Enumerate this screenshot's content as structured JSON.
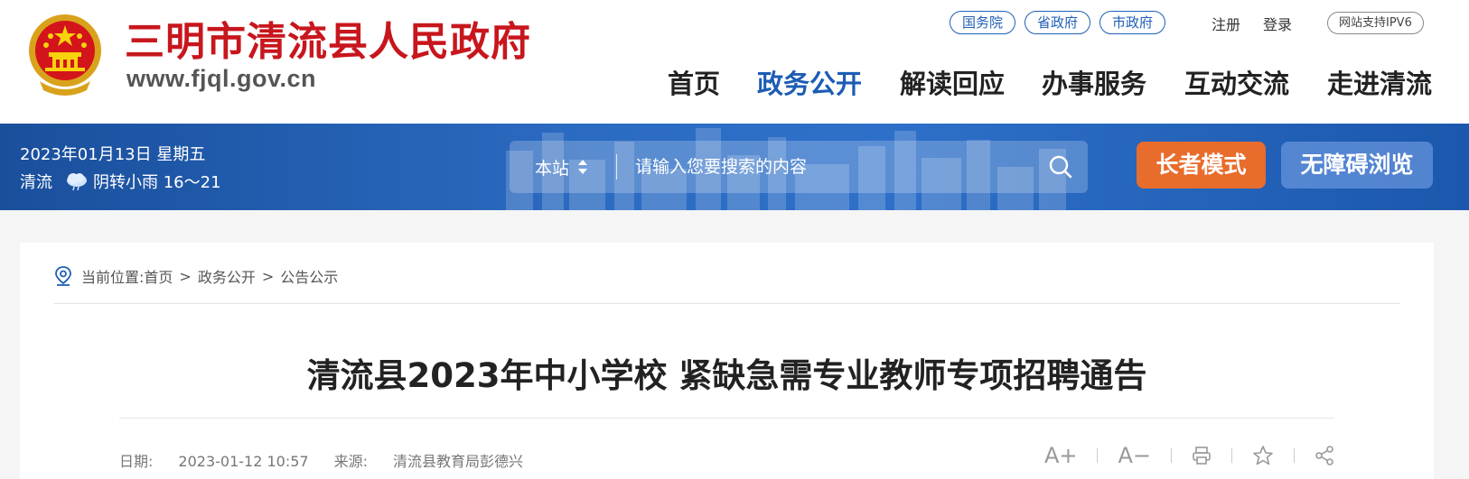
{
  "header": {
    "site_name": "三明市清流县人民政府",
    "site_domain": "www.fjql.gov.cn",
    "gov_links": [
      "国务院",
      "省政府",
      "市政府"
    ],
    "register": "注册",
    "login": "登录",
    "ipv6": "网站支持IPV6",
    "nav": [
      "首页",
      "政务公开",
      "解读回应",
      "办事服务",
      "互动交流",
      "走进清流"
    ],
    "active_nav": "政务公开"
  },
  "banner": {
    "date": "2023年01月13日 星期五",
    "city": "清流",
    "weather": "阴转小雨 16～21",
    "weather_icon": "cloud-rain-icon",
    "search": {
      "scope": "本站",
      "placeholder": "请输入您要搜索的内容"
    },
    "elder_mode": "长者模式",
    "accessible": "无障碍浏览"
  },
  "article": {
    "breadcrumb_label": "当前位置:",
    "breadcrumb": [
      "首页",
      "政务公开",
      "公告公示"
    ],
    "title": "清流县2023年中小学校 紧缺急需专业教师专项招聘通告",
    "date_label": "日期:",
    "date": "2023-01-12 10:57",
    "source_label": "来源:",
    "source": "清流县教育局彭德兴",
    "tools": [
      "A+",
      "A−"
    ]
  },
  "colors": {
    "brand_red": "#c8161d",
    "nav_blue": "#1c5cb4",
    "banner_blue": "#2b6bc2",
    "elder_orange": "#e86c2c"
  }
}
